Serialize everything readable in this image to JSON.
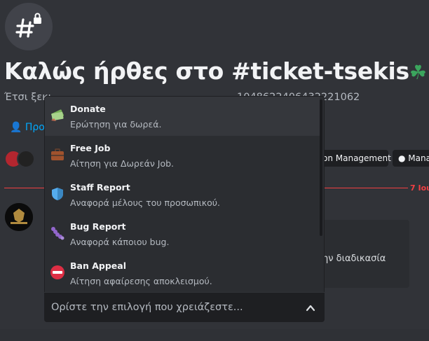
{
  "welcome": {
    "title": "Καλώς ήρθες στο #ticket-tsekis",
    "title_emoji": "☘",
    "title_suffix": "!",
    "subtitle_start": "Έτσι ξεκι",
    "subtitle_end": "1048622406432221062"
  },
  "header": {
    "add_members_label": "Προ"
  },
  "roles": [
    {
      "label": "on Management"
    },
    {
      "label": "● Manag"
    }
  ],
  "divider": {
    "date": "7 Ιου"
  },
  "embed": {
    "text": "ην διαδικασία"
  },
  "dropdown": {
    "options": [
      {
        "label": "Donate",
        "description": "Ερώτηση για δωρεά.",
        "icon": "money-icon"
      },
      {
        "label": "Free Job",
        "description": "Αίτηση για Δωρεάν Job.",
        "icon": "briefcase-icon"
      },
      {
        "label": "Staff Report",
        "description": "Αναφορά μέλους του προσωπικού.",
        "icon": "shield-icon"
      },
      {
        "label": "Bug Report",
        "description": "Αναφορά κάποιου bug.",
        "icon": "bug-icon"
      },
      {
        "label": "Ban Appeal",
        "description": "Αίτηση αφαίρεσης αποκλεισμού.",
        "icon": "no-entry-icon"
      }
    ],
    "placeholder": "Ορίστε την επιλογή που χρειάζεστε..."
  },
  "colors": {
    "background": "#313338",
    "dropdown": "#2b2d31",
    "select": "#1e1f22",
    "accent_link": "#00a8fc",
    "divider_red": "#f23f43"
  }
}
